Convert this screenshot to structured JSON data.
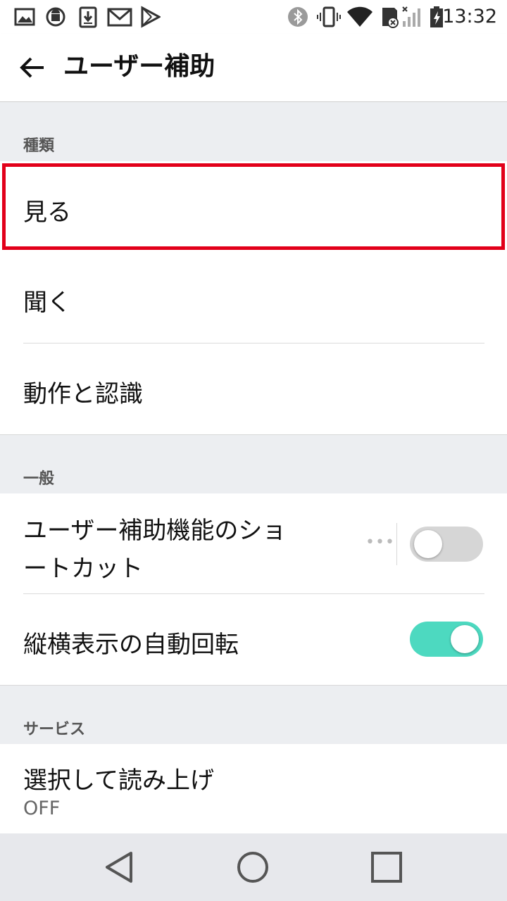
{
  "status_bar": {
    "clock": "13:32",
    "left_icons": [
      "image-icon",
      "android-sync-icon",
      "download-icon",
      "gmail-icon",
      "play-store-icon"
    ],
    "right_icons": [
      "bluetooth-icon",
      "vibrate-icon",
      "wifi-icon",
      "sd-card-icon",
      "signal-icon",
      "battery-charging-icon"
    ]
  },
  "app_bar": {
    "title": "ユーザー補助",
    "back_icon": "arrow-back-icon"
  },
  "sections": {
    "category": {
      "header": "種類",
      "items": [
        {
          "label": "見る",
          "highlighted": true
        },
        {
          "label": "聞く"
        },
        {
          "label": "動作と認識"
        }
      ]
    },
    "general": {
      "header": "一般",
      "shortcut": {
        "label_line1": "ユーザー補助機能のショ",
        "label_line2": "ートカット",
        "enabled": false
      },
      "auto_rotate": {
        "label": "縦横表示の自動回転",
        "enabled": true
      }
    },
    "services": {
      "header": "サービス",
      "select_to_speak": {
        "label": "選択して読み上げ",
        "status": "OFF"
      }
    }
  },
  "colors": {
    "highlight_border": "#e2001a",
    "toggle_on": "#4dd9c0",
    "toggle_off": "#d6d6d6",
    "section_bg": "#eceef1"
  },
  "nav_bar": {
    "icons": [
      "back-triangle-icon",
      "home-circle-icon",
      "recents-square-icon"
    ]
  }
}
